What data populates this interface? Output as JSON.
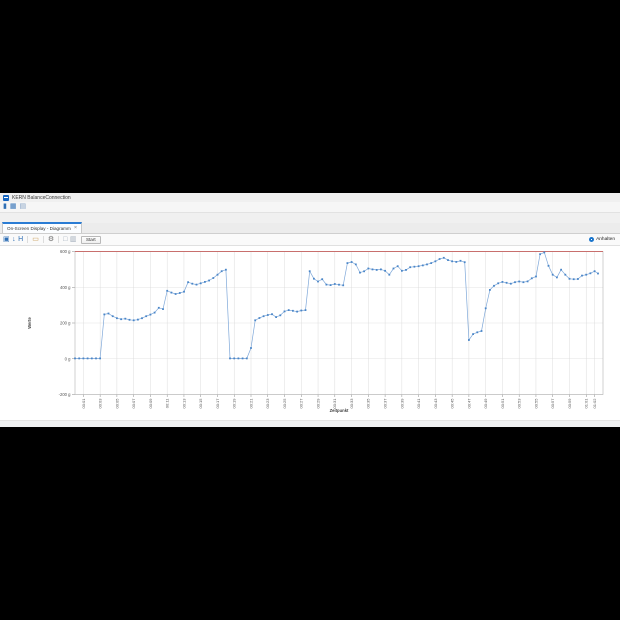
{
  "window": {
    "title": "KERN BalanceConnection"
  },
  "main_toolbar": {
    "icons": [
      {
        "name": "balance-device-icon",
        "glyph": "▮",
        "color": "#2f6fb5"
      },
      {
        "name": "data-table-icon",
        "glyph": "▦",
        "color": "#2f6fb5"
      },
      {
        "name": "report-icon",
        "glyph": "▤",
        "color": "#7f9ec4"
      }
    ]
  },
  "tabs": [
    {
      "label": "On-Screen Display - Diagramm",
      "close_glyph": "×",
      "active": true
    }
  ],
  "chart_toolbar": {
    "icons": [
      {
        "name": "copy-chart-icon",
        "glyph": "▣",
        "color": "#2f6fb5"
      },
      {
        "name": "save-image-icon",
        "glyph": "↓",
        "color": "#2f6fb5"
      },
      {
        "name": "measurement-series-icon",
        "glyph": "H",
        "color": "#2f6fb5"
      },
      {
        "sep": true
      },
      {
        "name": "export-icon",
        "glyph": "▭",
        "color": "#c89a53"
      },
      {
        "sep": true
      },
      {
        "name": "settings-gear-icon",
        "glyph": "⚙",
        "color": "#6b6b6b"
      },
      {
        "sep": true
      },
      {
        "name": "new-window-icon",
        "glyph": "□",
        "color": "#9aa7b5"
      },
      {
        "name": "layers-icon",
        "glyph": "▥",
        "color": "#9aa7b5"
      }
    ],
    "start_label": "Start",
    "stop_label": "Anhalten"
  },
  "chart_data": {
    "type": "line",
    "xlabel": "Zeitpunkt",
    "ylabel": "Werte",
    "xlim": [
      0,
      63
    ],
    "ylim": [
      -200,
      600
    ],
    "grid": true,
    "threshold": {
      "value": 600,
      "color": "#c86f6d"
    },
    "y_ticks": [
      {
        "v": -200,
        "label": "-200 g"
      },
      {
        "v": 0,
        "label": "0 g"
      },
      {
        "v": 200,
        "label": "200 g"
      },
      {
        "v": 400,
        "label": "400 g"
      },
      {
        "v": 600,
        "label": "600 g"
      }
    ],
    "x_ticks": [
      {
        "t": 1,
        "label": "00:01"
      },
      {
        "t": 3,
        "label": "00:03"
      },
      {
        "t": 5,
        "label": "00:05"
      },
      {
        "t": 7,
        "label": "00:07"
      },
      {
        "t": 9,
        "label": "00:09"
      },
      {
        "t": 11,
        "label": "00:11"
      },
      {
        "t": 13,
        "label": "00:13"
      },
      {
        "t": 15,
        "label": "00:15"
      },
      {
        "t": 17,
        "label": "00:17"
      },
      {
        "t": 19,
        "label": "00:19"
      },
      {
        "t": 21,
        "label": "00:21"
      },
      {
        "t": 23,
        "label": "00:23"
      },
      {
        "t": 25,
        "label": "00:25"
      },
      {
        "t": 27,
        "label": "00:27"
      },
      {
        "t": 29,
        "label": "00:29"
      },
      {
        "t": 31,
        "label": "00:31"
      },
      {
        "t": 33,
        "label": "00:33"
      },
      {
        "t": 35,
        "label": "00:35"
      },
      {
        "t": 37,
        "label": "00:37"
      },
      {
        "t": 39,
        "label": "00:39"
      },
      {
        "t": 41,
        "label": "00:41"
      },
      {
        "t": 43,
        "label": "00:43"
      },
      {
        "t": 45,
        "label": "00:45"
      },
      {
        "t": 47,
        "label": "00:47"
      },
      {
        "t": 49,
        "label": "00:49"
      },
      {
        "t": 51,
        "label": "00:51"
      },
      {
        "t": 53,
        "label": "00:53"
      },
      {
        "t": 55,
        "label": "00:55"
      },
      {
        "t": 57,
        "label": "00:57"
      },
      {
        "t": 59,
        "label": "00:59"
      },
      {
        "t": 61,
        "label": "01:01"
      },
      {
        "t": 62,
        "label": "01:02"
      }
    ],
    "series": [
      {
        "name": "weight-values",
        "line_color": "#7fa8d9",
        "marker_color": "#4a86c8",
        "points": [
          [
            0,
            2
          ],
          [
            0.5,
            2
          ],
          [
            1,
            2
          ],
          [
            1.5,
            2
          ],
          [
            2,
            2
          ],
          [
            2.5,
            2
          ],
          [
            3,
            2
          ],
          [
            3.5,
            248
          ],
          [
            4,
            253
          ],
          [
            4.5,
            238
          ],
          [
            5,
            227
          ],
          [
            5.5,
            221
          ],
          [
            6,
            224
          ],
          [
            6.5,
            218
          ],
          [
            7,
            215
          ],
          [
            7.5,
            219
          ],
          [
            8,
            227
          ],
          [
            8.5,
            238
          ],
          [
            9,
            247
          ],
          [
            9.5,
            258
          ],
          [
            10,
            285
          ],
          [
            10.5,
            278
          ],
          [
            11,
            380
          ],
          [
            11.5,
            370
          ],
          [
            12,
            362
          ],
          [
            12.5,
            368
          ],
          [
            13,
            375
          ],
          [
            13.5,
            428
          ],
          [
            14,
            420
          ],
          [
            14.5,
            415
          ],
          [
            15,
            422
          ],
          [
            15.5,
            430
          ],
          [
            16,
            438
          ],
          [
            16.5,
            452
          ],
          [
            17,
            470
          ],
          [
            17.5,
            490
          ],
          [
            18,
            498
          ],
          [
            18.5,
            2
          ],
          [
            19,
            2
          ],
          [
            19.5,
            2
          ],
          [
            20,
            2
          ],
          [
            20.5,
            2
          ],
          [
            21,
            60
          ],
          [
            21.5,
            215
          ],
          [
            22,
            228
          ],
          [
            22.5,
            238
          ],
          [
            23,
            245
          ],
          [
            23.5,
            249
          ],
          [
            24,
            233
          ],
          [
            24.5,
            243
          ],
          [
            25,
            265
          ],
          [
            25.5,
            272
          ],
          [
            26,
            268
          ],
          [
            26.5,
            264
          ],
          [
            27,
            270
          ],
          [
            27.5,
            272
          ],
          [
            28,
            490
          ],
          [
            28.5,
            448
          ],
          [
            29,
            432
          ],
          [
            29.5,
            445
          ],
          [
            30,
            415
          ],
          [
            30.5,
            412
          ],
          [
            31,
            418
          ],
          [
            31.5,
            414
          ],
          [
            32,
            411
          ],
          [
            32.5,
            535
          ],
          [
            33,
            541
          ],
          [
            33.5,
            528
          ],
          [
            34,
            482
          ],
          [
            34.5,
            489
          ],
          [
            35,
            505
          ],
          [
            35.5,
            500
          ],
          [
            36,
            497
          ],
          [
            36.5,
            500
          ],
          [
            37,
            492
          ],
          [
            37.5,
            470
          ],
          [
            38,
            505
          ],
          [
            38.5,
            518
          ],
          [
            39,
            492
          ],
          [
            39.5,
            497
          ],
          [
            40,
            512
          ],
          [
            40.5,
            515
          ],
          [
            41,
            518
          ],
          [
            41.5,
            522
          ],
          [
            42,
            528
          ],
          [
            42.5,
            535
          ],
          [
            43,
            545
          ],
          [
            43.5,
            558
          ],
          [
            44,
            565
          ],
          [
            44.5,
            552
          ],
          [
            45,
            545
          ],
          [
            45.5,
            542
          ],
          [
            46,
            548
          ],
          [
            46.5,
            540
          ],
          [
            47,
            105
          ],
          [
            47.5,
            138
          ],
          [
            48,
            148
          ],
          [
            48.5,
            155
          ],
          [
            49,
            282
          ],
          [
            49.5,
            385
          ],
          [
            50,
            408
          ],
          [
            50.5,
            422
          ],
          [
            51,
            430
          ],
          [
            51.5,
            425
          ],
          [
            52,
            420
          ],
          [
            52.5,
            428
          ],
          [
            53,
            432
          ],
          [
            53.5,
            428
          ],
          [
            54,
            433
          ],
          [
            54.5,
            450
          ],
          [
            55,
            460
          ],
          [
            55.5,
            585
          ],
          [
            56,
            595
          ],
          [
            56.5,
            520
          ],
          [
            57,
            470
          ],
          [
            57.5,
            455
          ],
          [
            58,
            498
          ],
          [
            58.5,
            470
          ],
          [
            59,
            447
          ],
          [
            59.5,
            445
          ],
          [
            60,
            446
          ],
          [
            60.5,
            465
          ],
          [
            61,
            470
          ],
          [
            61.5,
            478
          ],
          [
            62,
            490
          ],
          [
            62.4,
            477
          ]
        ]
      }
    ]
  }
}
